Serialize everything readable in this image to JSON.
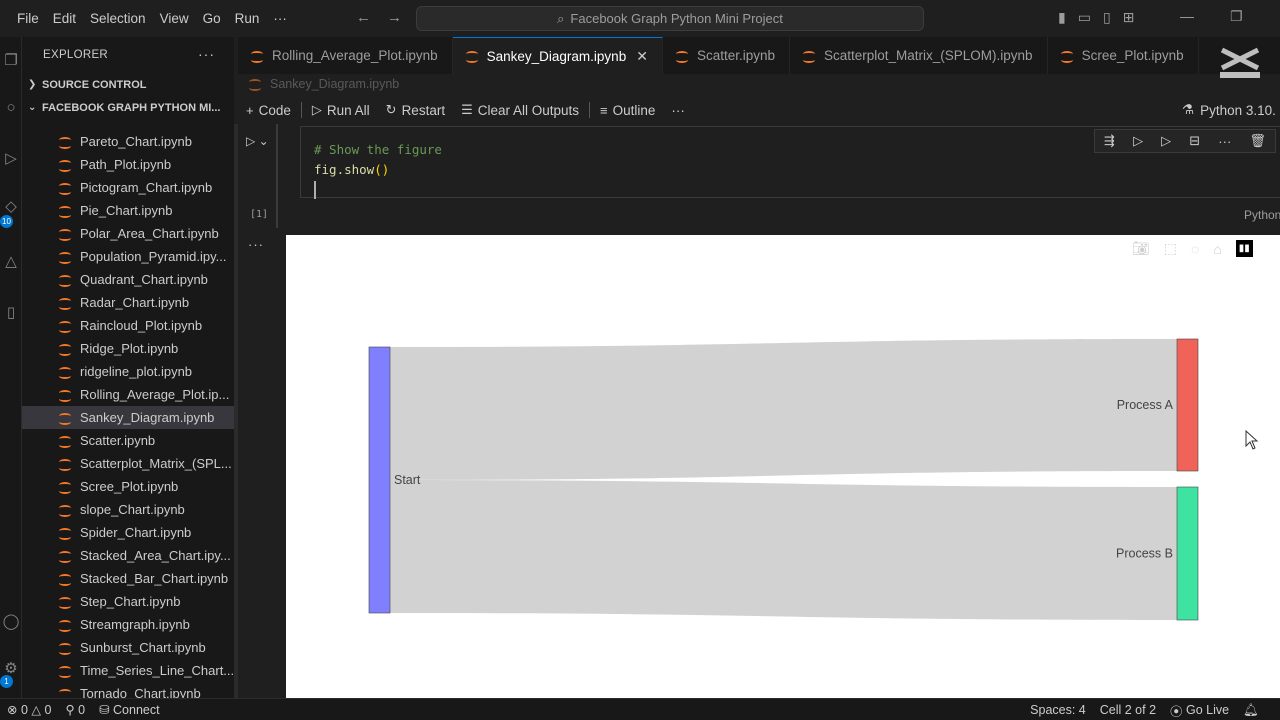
{
  "menu": [
    "File",
    "Edit",
    "Selection",
    "View",
    "Go",
    "Run",
    "···"
  ],
  "command_center": "Facebook Graph Python Mini Project",
  "sidebar": {
    "title": "EXPLORER",
    "more": "···",
    "source_control": "SOURCE CONTROL",
    "project": "FACEBOOK GRAPH PYTHON MI...",
    "files": [
      "Pareto_Chart.ipynb",
      "Path_Plot.ipynb",
      "Pictogram_Chart.ipynb",
      "Pie_Chart.ipynb",
      "Polar_Area_Chart.ipynb",
      "Population_Pyramid.ipy...",
      "Quadrant_Chart.ipynb",
      "Radar_Chart.ipynb",
      "Raincloud_Plot.ipynb",
      "Ridge_Plot.ipynb",
      "ridgeline_plot.ipynb",
      "Rolling_Average_Plot.ip...",
      "Sankey_Diagram.ipynb",
      "Scatter.ipynb",
      "Scatterplot_Matrix_(SPL...",
      "Scree_Plot.ipynb",
      "slope_Chart.ipynb",
      "Spider_Chart.ipynb",
      "Stacked_Area_Chart.ipy...",
      "Stacked_Bar_Chart.ipynb",
      "Step_Chart.ipynb",
      "Streamgraph.ipynb",
      "Sunburst_Chart.ipynb",
      "Time_Series_Line_Chart...",
      "Tornado_Chart.ipynb"
    ],
    "active_file_index": 12
  },
  "tabs": [
    {
      "label": "Rolling_Average_Plot.ipynb",
      "active": false
    },
    {
      "label": "Sankey_Diagram.ipynb",
      "active": true
    },
    {
      "label": "Scatter.ipynb",
      "active": false
    },
    {
      "label": "Scatterplot_Matrix_(SPLOM).ipynb",
      "active": false
    },
    {
      "label": "Scree_Plot.ipynb",
      "active": false
    }
  ],
  "breadcrumb": "Sankey_Diagram.ipynb",
  "toolbar": {
    "code": "Code",
    "run_all": "Run All",
    "restart": "Restart",
    "clear": "Clear All Outputs",
    "outline": "Outline",
    "more": "···",
    "kernel": "Python 3.10."
  },
  "cell": {
    "exec_count": "[1]",
    "comment": "# Show the figure",
    "code_fn": "fig.show",
    "code_parens": "()",
    "language": "Python"
  },
  "chart_data": {
    "type": "sankey",
    "nodes": [
      {
        "label": "Start",
        "color": "#8080ff"
      },
      {
        "label": "Process A",
        "color": "#ef6358"
      },
      {
        "label": "Process B",
        "color": "#3ee3a2"
      }
    ],
    "links": [
      {
        "source": "Start",
        "target": "Process A",
        "value": 1
      },
      {
        "source": "Start",
        "target": "Process B",
        "value": 1
      }
    ],
    "link_color": "#d0d0d0"
  },
  "statusbar": {
    "errors": "0",
    "warnings": "0",
    "ports": "0",
    "connect": "Connect",
    "spaces": "Spaces: 4",
    "cell": "Cell 2 of 2",
    "golive": "Go Live"
  }
}
